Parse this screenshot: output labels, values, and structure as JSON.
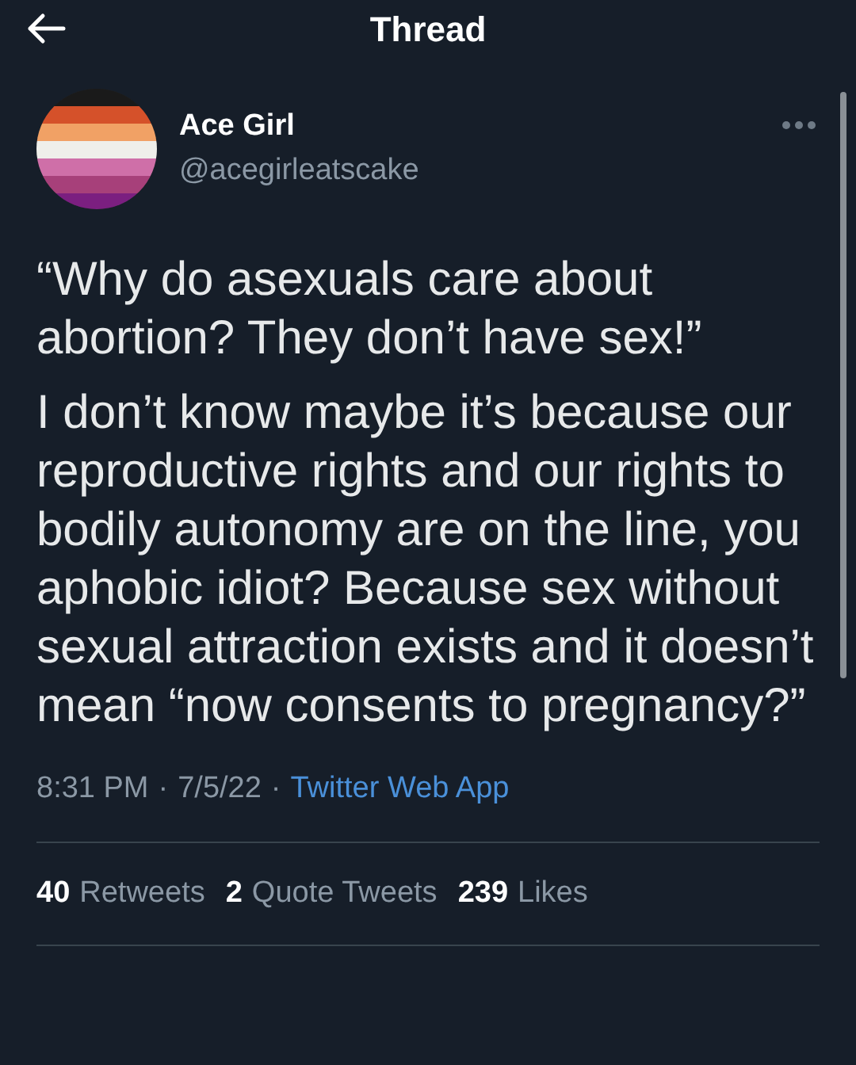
{
  "header": {
    "title": "Thread"
  },
  "author": {
    "name": "Ace Girl",
    "handle": "@acegirleatscake"
  },
  "paragraphs": [
    "“Why do asexuals care about abortion? They don’t have sex!”",
    "I don’t know maybe it’s because our reproductive rights and our rights to bodily autonomy are on the line, you aphobic idiot? Because sex without sexual attraction exists and it doesn’t mean “now consents to pregnancy?”"
  ],
  "meta": {
    "time": "8:31 PM",
    "separator_1": "·",
    "date": "7/5/22",
    "separator_2": "·",
    "source": "Twitter Web App"
  },
  "stats": [
    {
      "count": "40",
      "label": "Retweets"
    },
    {
      "count": "2",
      "label": "Quote Tweets"
    },
    {
      "count": "239",
      "label": "Likes"
    }
  ]
}
